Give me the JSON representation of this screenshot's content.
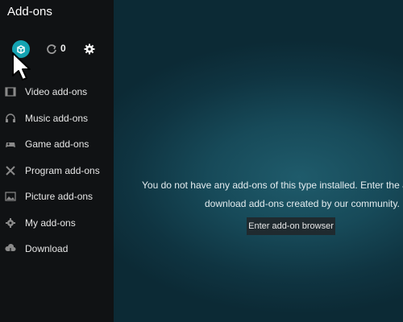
{
  "window": {
    "title": "Add-ons"
  },
  "toolbar": {
    "update_count": "0",
    "icons": [
      "addon-box-icon",
      "refresh-icon",
      "gear-icon"
    ],
    "accent_color": "#15a3b2"
  },
  "sidebar": {
    "items": [
      {
        "label": "Video add-ons",
        "icon": "film-icon"
      },
      {
        "label": "Music add-ons",
        "icon": "headphones-icon"
      },
      {
        "label": "Game add-ons",
        "icon": "gamepad-icon"
      },
      {
        "label": "Program add-ons",
        "icon": "tools-icon"
      },
      {
        "label": "Picture add-ons",
        "icon": "picture-icon"
      },
      {
        "label": "My add-ons",
        "icon": "gear-icon"
      },
      {
        "label": "Download",
        "icon": "cloud-download-icon"
      }
    ]
  },
  "main": {
    "message_line1": "You do not have any add-ons of this type installed. Enter the add-on b",
    "message_line2": "download add-ons created by our community.",
    "browser_button_label": "Enter add-on browser"
  }
}
